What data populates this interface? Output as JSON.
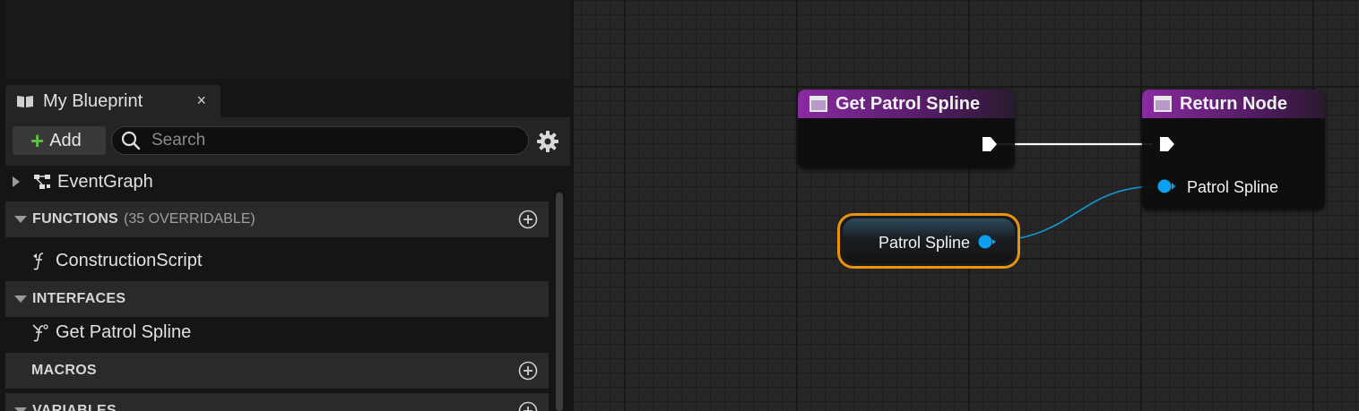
{
  "my_blueprint_panel": {
    "tab_title": "My Blueprint",
    "tab_close": "×",
    "add_button_label": "Add",
    "search_placeholder": "Search",
    "event_graph_label": "EventGraph",
    "categories": {
      "functions": {
        "name": "FUNCTIONS",
        "sub": "(35 OVERRIDABLE)"
      },
      "interfaces": {
        "name": "INTERFACES"
      },
      "macros": {
        "name": "MACROS"
      },
      "variables": {
        "name": "VARIABLES"
      }
    },
    "function_items": [
      "ConstructionScript"
    ],
    "interface_items": [
      "Get Patrol Spline"
    ]
  },
  "graph": {
    "get_node": {
      "title": "Get Patrol Spline"
    },
    "return_node": {
      "title": "Return Node",
      "input_label": "Patrol Spline"
    },
    "variable_node": {
      "label": "Patrol Spline"
    },
    "colors": {
      "function_header": "#8a2aa2",
      "object_pin": "#0ea0f0",
      "exec_pin": "#ffffff",
      "selection_outline": "#e8940e"
    }
  },
  "icons": [
    "book-icon",
    "close-icon",
    "plus-icon",
    "search-icon",
    "gear-icon",
    "expand-arrow-icon",
    "event-graph-icon",
    "construction-script-icon",
    "interface-function-icon",
    "add-circle-icon",
    "function-icon",
    "exec-pin-icon",
    "object-pin-icon"
  ]
}
